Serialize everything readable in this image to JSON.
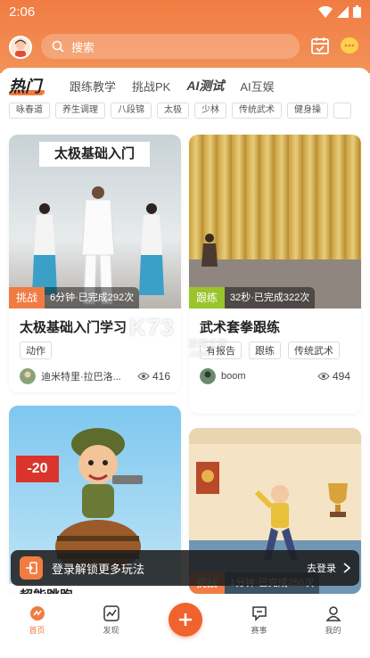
{
  "status": {
    "time": "2:06"
  },
  "search": {
    "placeholder": "搜索"
  },
  "tabs": {
    "hot": "热门",
    "items": [
      "跟练教学",
      "挑战PK",
      "AI测试",
      "AI互娱"
    ]
  },
  "categories": [
    "咏春道",
    "养生调理",
    "八段锦",
    "太极",
    "少林",
    "传统武术",
    "健身操"
  ],
  "cards": [
    {
      "image_title": "太极基础入门",
      "tag": "挑战",
      "tag_color": "#f07c43",
      "info": "6分钟·已完成292次",
      "title": "太极基础入门学习",
      "tags": [
        "动作"
      ],
      "author": "迪米特里·拉巴洛...",
      "views": "416"
    },
    {
      "tag": "跟练",
      "tag_color": "#9ac42c",
      "info": "32秒·已完成322次",
      "title": "武术套拳跟练",
      "tags": [
        "有报告",
        "跟练",
        "传统武术"
      ],
      "author": "boom",
      "views": "494"
    },
    {
      "image_label": "-20",
      "title": "超能跳跑"
    },
    {
      "tag": "挑战",
      "tag_color": "#f07c43",
      "info": "1分钟·已完成250次"
    }
  ],
  "watermark": {
    "main": "K73",
    "sub": "游戏之家",
    "domain": ".com"
  },
  "toast": {
    "message": "登录解锁更多玩法",
    "action": "去登录"
  },
  "nav": [
    "首页",
    "发现",
    "赛事",
    "我的"
  ],
  "colors": {
    "accent": "#f07c43",
    "challenge": "#f07c43",
    "follow": "#9ac42c"
  }
}
